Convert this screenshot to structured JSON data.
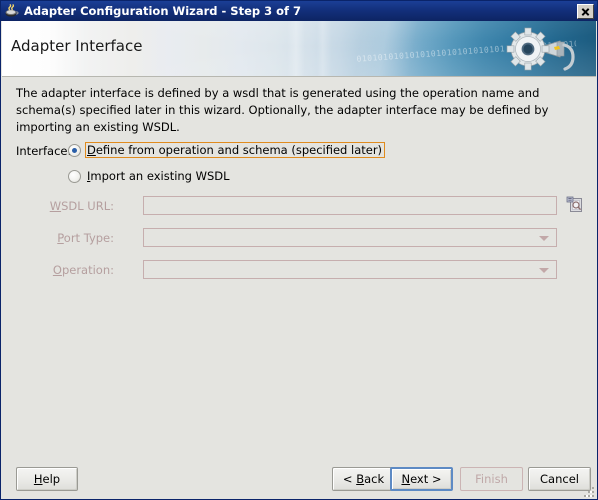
{
  "window": {
    "title": "Adapter Configuration Wizard - Step 3 of 7",
    "icon": "java-coffee-cup-icon",
    "close_label": "Close"
  },
  "banner": {
    "heading": "Adapter Interface",
    "graphic": "gear-wrench-icon",
    "binary_text": "0101010101010101010101010101 0101010101010101010101 01010101010101"
  },
  "main": {
    "description": "The adapter interface is defined by a wsdl that is generated using the operation name and schema(s) specified later in this wizard.  Optionally, the adapter interface may be defined by importing an existing WSDL.",
    "interface_label": "Interface:",
    "options": [
      {
        "label": "Define from operation and schema (specified later)",
        "mnemonic": "D",
        "selected": true,
        "focused": true
      },
      {
        "label": "Import an existing WSDL",
        "mnemonic": "I",
        "selected": false,
        "focused": false
      }
    ],
    "fields": [
      {
        "label": "WSDL URL:",
        "mnemonic": "W",
        "value": "",
        "type": "text",
        "disabled": true
      },
      {
        "label": "Port Type:",
        "mnemonic": "P",
        "value": "",
        "type": "combobox",
        "disabled": true
      },
      {
        "label": "Operation:",
        "mnemonic": "O",
        "value": "",
        "type": "combobox",
        "disabled": true
      }
    ],
    "browse_button": {
      "icon": "browse-wsdl-icon",
      "title": "Browse"
    }
  },
  "footer": {
    "buttons": [
      {
        "name": "help",
        "label": "Help",
        "mnemonic": "H",
        "disabled": false,
        "default": false
      },
      {
        "name": "back",
        "label": "< Back",
        "mnemonic": "B",
        "disabled": false,
        "default": false
      },
      {
        "name": "next",
        "label": "Next >",
        "mnemonic": "N",
        "disabled": false,
        "default": true
      },
      {
        "name": "finish",
        "label": "Finish",
        "mnemonic": "F",
        "disabled": true,
        "default": false
      },
      {
        "name": "cancel",
        "label": "Cancel",
        "mnemonic": "",
        "disabled": false,
        "default": false
      }
    ]
  },
  "colors": {
    "titlebar": "#13307c",
    "banner_right": "#1d5c80",
    "focus_ring": "#e08b1e",
    "default_button_border": "#5d8ac4",
    "dialog_bg": "#e4e4e0",
    "disabled_text": "#b59f9f"
  }
}
